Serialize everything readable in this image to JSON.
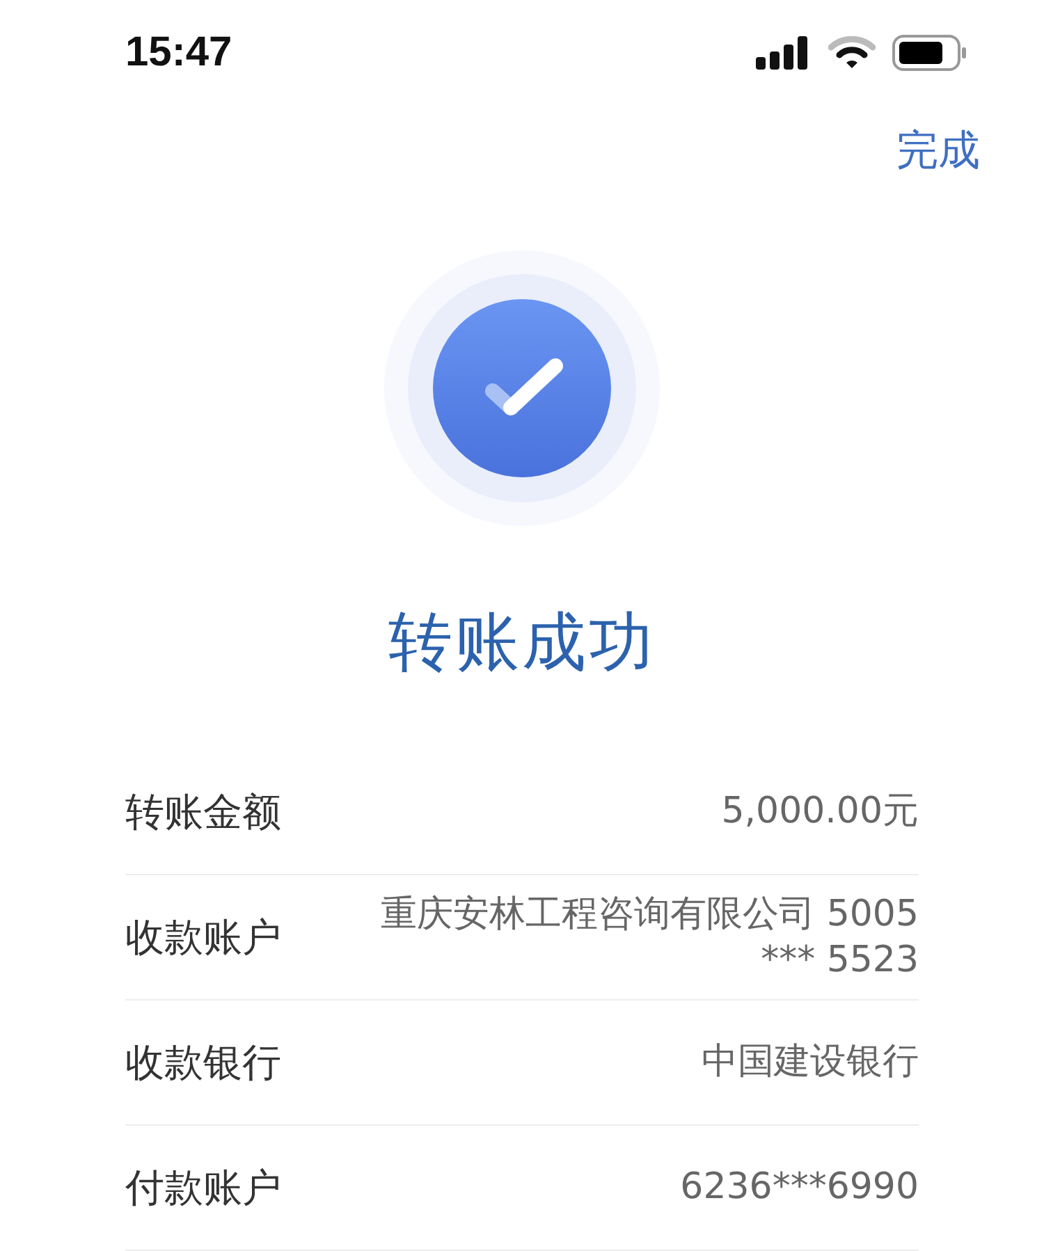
{
  "status_bar": {
    "time": "15:47"
  },
  "nav": {
    "done": "完成"
  },
  "result": {
    "title": "转账成功"
  },
  "details": [
    {
      "label": "转账金额",
      "value": "5,000.00元"
    },
    {
      "label": "收款账户",
      "value": "重庆安林工程咨询有限公司 5005 *** 5523"
    },
    {
      "label": "收款银行",
      "value": "中国建设银行"
    },
    {
      "label": "付款账户",
      "value": "6236***6990"
    }
  ]
}
